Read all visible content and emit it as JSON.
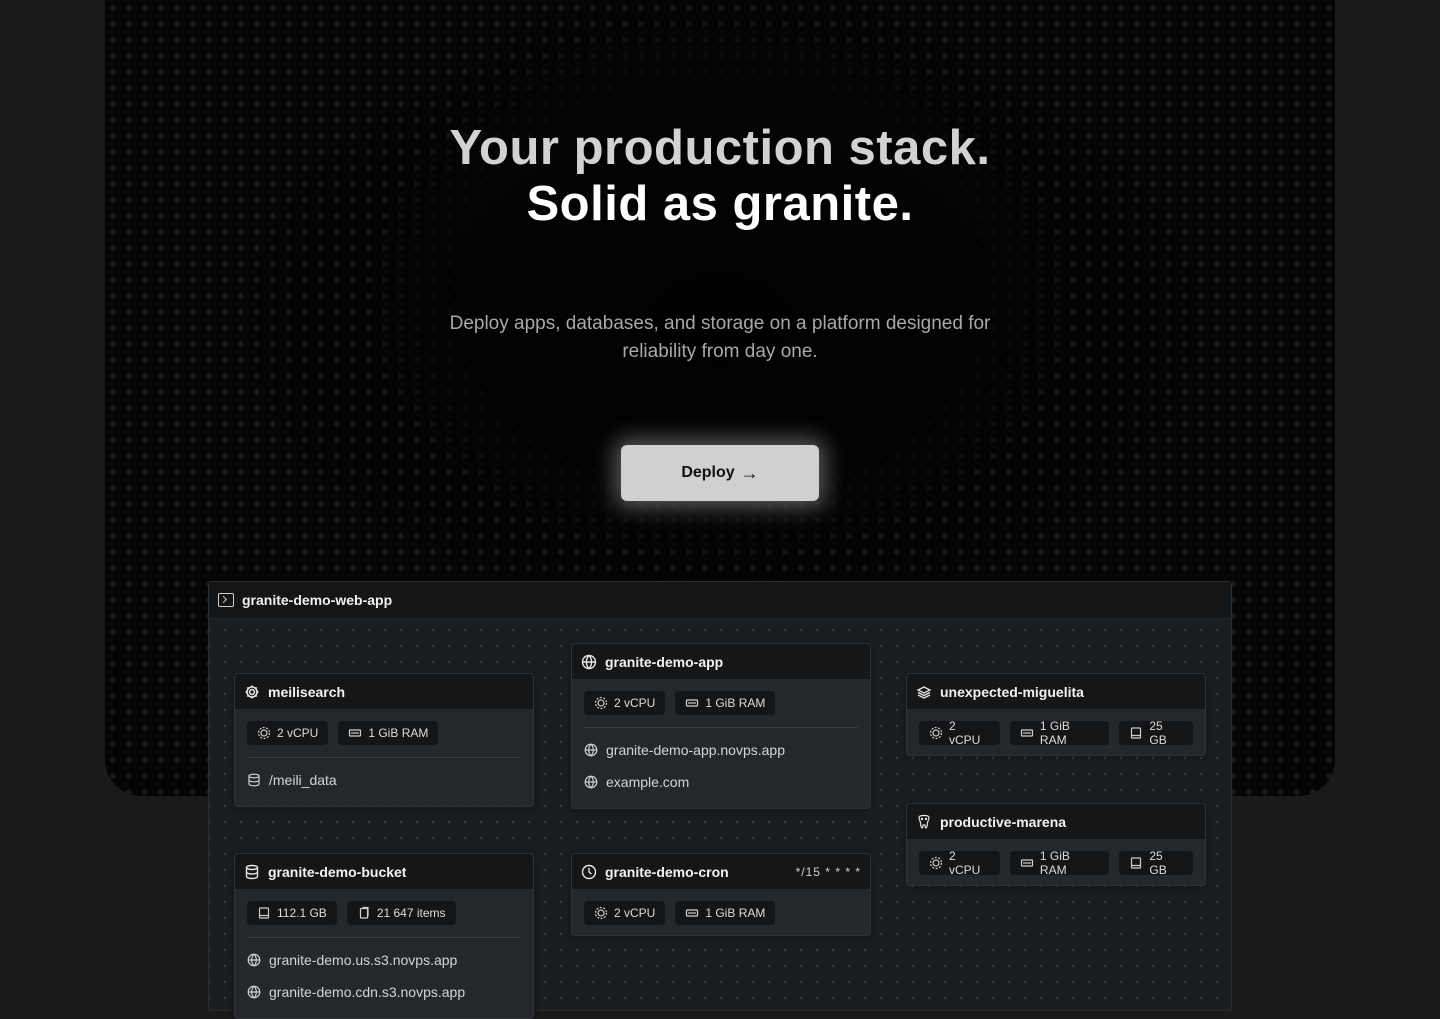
{
  "hero": {
    "title_line1": "Your production stack.",
    "title_line2": "Solid as granite.",
    "subtitle_line1": "Deploy apps, databases, and storage on a platform designed for",
    "subtitle_line2": "reliability from day one.",
    "deploy_label": "Deploy",
    "deploy_arrow": "→"
  },
  "project": {
    "name": "granite-demo-web-app",
    "cards": {
      "meilisearch": {
        "name": "meilisearch",
        "icon": "gear-icon",
        "cpu": "2 vCPU",
        "ram": "1 GiB RAM",
        "volume": "/meili_data"
      },
      "app": {
        "name": "granite-demo-app",
        "icon": "globe-icon",
        "cpu": "2 vCPU",
        "ram": "1 GiB RAM",
        "domains": [
          "granite-demo-app.novps.app",
          "example.com"
        ]
      },
      "miguelita": {
        "name": "unexpected-miguelita",
        "icon": "layers-icon",
        "cpu": "2 vCPU",
        "ram": "1 GiB RAM",
        "disk": "25 GB"
      },
      "marena": {
        "name": "productive-marena",
        "icon": "postgres-elephant-icon",
        "cpu": "2 vCPU",
        "ram": "1 GiB RAM",
        "disk": "25 GB"
      },
      "bucket": {
        "name": "granite-demo-bucket",
        "icon": "database-icon",
        "size": "112.1 GB",
        "items": "21 647 items",
        "domains": [
          "granite-demo.us.s3.novps.app",
          "granite-demo.cdn.s3.novps.app"
        ]
      },
      "cron": {
        "name": "granite-demo-cron",
        "icon": "clock-icon",
        "schedule": "*/15 * * * *",
        "cpu": "2 vCPU",
        "ram": "1 GiB RAM"
      }
    }
  },
  "colors": {
    "page_bg": "#1a1a1a",
    "hero_bg": "#050505",
    "card_bg": "#24282c",
    "card_header_bg": "#141618",
    "button_bg": "#d0d0d0"
  }
}
